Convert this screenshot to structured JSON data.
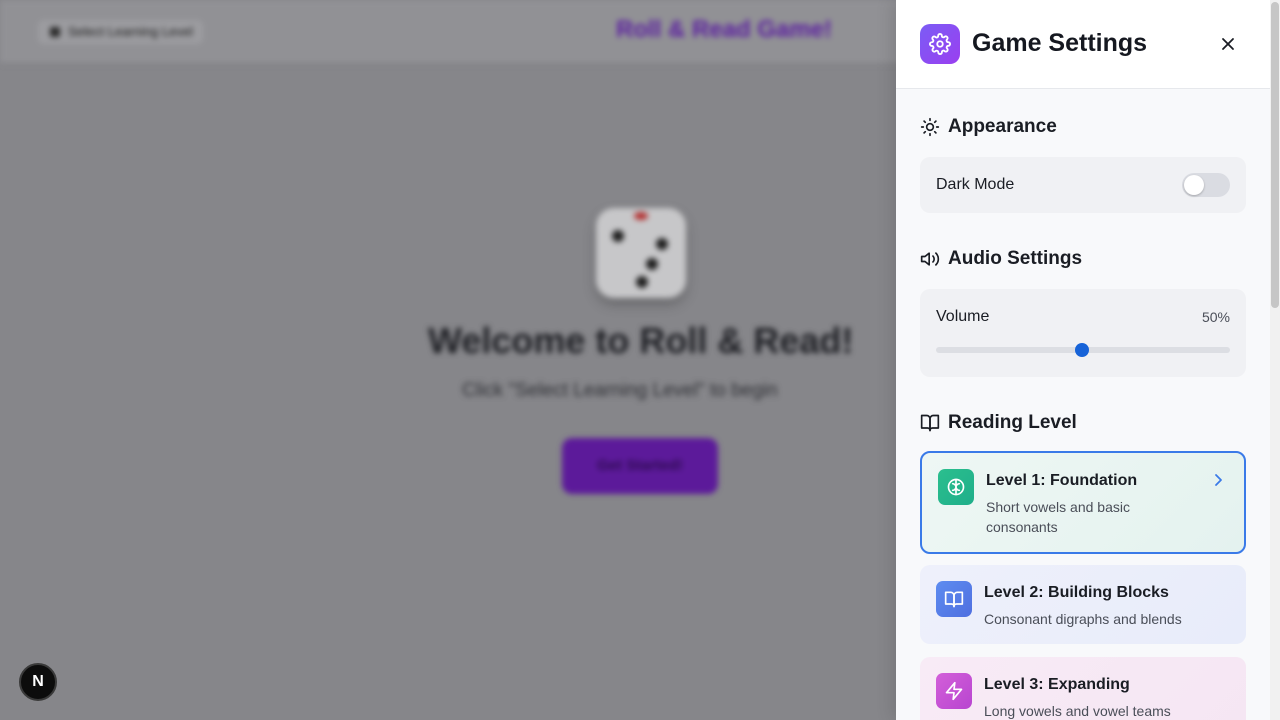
{
  "background": {
    "level_button": "Select Learning Level",
    "game_title": "Roll & Read Game!",
    "welcome": "Welcome to Roll & Read!",
    "subtitle": "Click \"Select Learning Level\" to begin",
    "start_button": "Get Started!"
  },
  "dev_badge": "N",
  "panel": {
    "title": "Game Settings",
    "appearance": {
      "heading": "Appearance",
      "dark_mode_label": "Dark Mode",
      "dark_mode_on": false
    },
    "audio": {
      "heading": "Audio Settings",
      "volume_label": "Volume",
      "volume_value": "50%",
      "volume_fraction": 0.5
    },
    "reading": {
      "heading": "Reading Level",
      "levels": [
        {
          "title": "Level 1: Foundation",
          "desc": "Short vowels and basic consonants",
          "icon": "brain-icon",
          "color": "#2bbf8e",
          "selected": true
        },
        {
          "title": "Level 2: Building Blocks",
          "desc": "Consonant digraphs and blends",
          "icon": "book-icon",
          "color": "#4f7be8",
          "selected": false
        },
        {
          "title": "Level 3: Expanding",
          "desc": "Long vowels and vowel teams",
          "icon": "zap-icon",
          "color": "#c64fd6",
          "selected": false
        }
      ]
    }
  },
  "colors": {
    "accent_purple": "#8b4cf2",
    "slider_blue": "#1763d8",
    "selected_border": "#3a7ae8"
  }
}
